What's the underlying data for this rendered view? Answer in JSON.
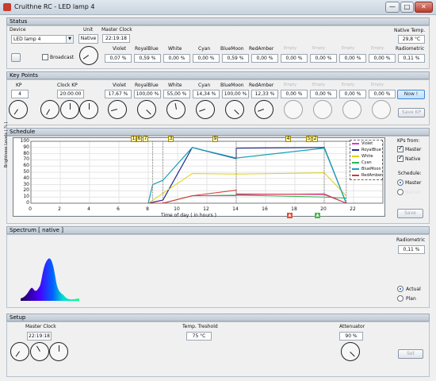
{
  "window": {
    "title": "Cruithne RC   -   LED lamp 4",
    "minimize": "—",
    "maximize": "□",
    "close": "✕"
  },
  "status": {
    "title": "Status",
    "device_label": "Device",
    "device_value": "LED lamp 4",
    "unit_label": "Unit",
    "unit_value": "Native",
    "master_clock_label": "Master Clock",
    "master_clock_value": "22:19:18",
    "broadcast_label": "Broadcast",
    "native_temp_label": "Native  Temp.",
    "native_temp_value": "29,8 °C",
    "radiometric_label": "Radiometric",
    "radiometric_value": "0,11 %",
    "channels": [
      {
        "label": "Violet",
        "value": "0,07 %"
      },
      {
        "label": "RoyalBlue",
        "value": "0,59 %"
      },
      {
        "label": "White",
        "value": "0,00 %"
      },
      {
        "label": "Cyan",
        "value": "0,00 %"
      },
      {
        "label": "BlueMoon",
        "value": "0,59 %"
      },
      {
        "label": "RedAmber",
        "value": "0,00 %"
      },
      {
        "label": "Empty",
        "value": "0,00 %"
      },
      {
        "label": "Empty",
        "value": "0,00 %"
      },
      {
        "label": "Empty",
        "value": "0,00 %"
      },
      {
        "label": "Empty",
        "value": "0,00 %"
      }
    ]
  },
  "keypoints": {
    "title": "Key Points",
    "kp_label": "KP",
    "kp_value": "4",
    "clock_kp_label": "Clock  KP",
    "clock_kp_value": "20:00:00",
    "now_button": "Now !",
    "save_button": "Save  KP",
    "channels": [
      {
        "label": "Violet",
        "value": "17,67 %"
      },
      {
        "label": "RoyalBlue",
        "value": "100,00 %"
      },
      {
        "label": "White",
        "value": "55,00 %"
      },
      {
        "label": "Cyan",
        "value": "14,34 %"
      },
      {
        "label": "BlueMoon",
        "value": "100,00 %"
      },
      {
        "label": "RedAmber",
        "value": "12,33 %"
      },
      {
        "label": "Empty",
        "value": "0,00 %"
      },
      {
        "label": "Empty",
        "value": "0,00 %"
      },
      {
        "label": "Empty",
        "value": "0,00 %"
      },
      {
        "label": "Empty",
        "value": "0,00 %"
      }
    ]
  },
  "schedule": {
    "title": "Schedule",
    "kps_from_label": "KPs from:",
    "master_label": "Master",
    "native_label": "Native",
    "schedule_label": "Schedule:",
    "schedule_master": "Master",
    "schedule_native": "Native",
    "save_button": "Save",
    "markers": [
      "1",
      "6",
      "7",
      "3",
      "9",
      "4",
      "5",
      "2"
    ],
    "event_markers": [
      "▲",
      "▲"
    ]
  },
  "spectrum": {
    "title": "Spectrum  [ native ]",
    "radiometric_label": "Radiometric",
    "radiometric_value": "0,11 %",
    "actual_label": "Actual",
    "plan_label": "Plan"
  },
  "setup": {
    "title": "Setup",
    "master_clock_label": "Master Clock",
    "master_clock_value": "22:19:18",
    "temp_label": "Temp. Treshold",
    "temp_value": "75 °C",
    "attenuator_label": "Attenuator",
    "attenuator_value": "90 %",
    "set_button": "Set"
  },
  "chart_data": {
    "type": "line",
    "title": "",
    "xlabel": "Time of day  ( in hours )",
    "ylabel": "Brightness Levels  ( % )",
    "xlim": [
      0,
      24
    ],
    "ylim": [
      0,
      100
    ],
    "x_ticks": [
      "0",
      "2",
      "4",
      "6",
      "8",
      "10",
      "12",
      "14",
      "16",
      "18",
      "20",
      "22"
    ],
    "y_ticks": [
      "0",
      "10",
      "20",
      "30",
      "40",
      "50",
      "60",
      "70",
      "80",
      "90",
      "100"
    ],
    "legend_position": "top-right",
    "series": [
      {
        "name": "Violet",
        "color": "#d43bd8",
        "points": [
          [
            8,
            0
          ],
          [
            9,
            0
          ],
          [
            11,
            12
          ],
          [
            14,
            12
          ],
          [
            14,
            15
          ],
          [
            20,
            14
          ],
          [
            21.5,
            0
          ]
        ]
      },
      {
        "name": "RoyalBlue",
        "color": "#242c8e",
        "points": [
          [
            8,
            0
          ],
          [
            9,
            5
          ],
          [
            11,
            90
          ],
          [
            14,
            72
          ],
          [
            14,
            89
          ],
          [
            20,
            90
          ],
          [
            21.5,
            0
          ]
        ]
      },
      {
        "name": "White",
        "color": "#e0d200",
        "points": [
          [
            8,
            0
          ],
          [
            9,
            16
          ],
          [
            11,
            48
          ],
          [
            14,
            47
          ],
          [
            14,
            47
          ],
          [
            20,
            49
          ],
          [
            21.5,
            12
          ]
        ]
      },
      {
        "name": "Cyan",
        "color": "#2bb34f",
        "points": [
          [
            8,
            0
          ],
          [
            9,
            0
          ],
          [
            11,
            12
          ],
          [
            14,
            13
          ],
          [
            14,
            13
          ],
          [
            20,
            10
          ],
          [
            21.5,
            8
          ]
        ]
      },
      {
        "name": "BlueMoon",
        "color": "#16a3b6",
        "points": [
          [
            8,
            0
          ],
          [
            8.3,
            30
          ],
          [
            9,
            37
          ],
          [
            11,
            90
          ],
          [
            14,
            73
          ],
          [
            14,
            73
          ],
          [
            20,
            89
          ],
          [
            21.5,
            0
          ]
        ]
      },
      {
        "name": "RedAmber",
        "color": "#d73731",
        "points": [
          [
            8,
            0
          ],
          [
            9,
            0
          ],
          [
            11,
            12
          ],
          [
            14,
            21
          ],
          [
            14,
            14
          ],
          [
            20,
            15
          ],
          [
            21.5,
            0
          ]
        ]
      }
    ]
  }
}
